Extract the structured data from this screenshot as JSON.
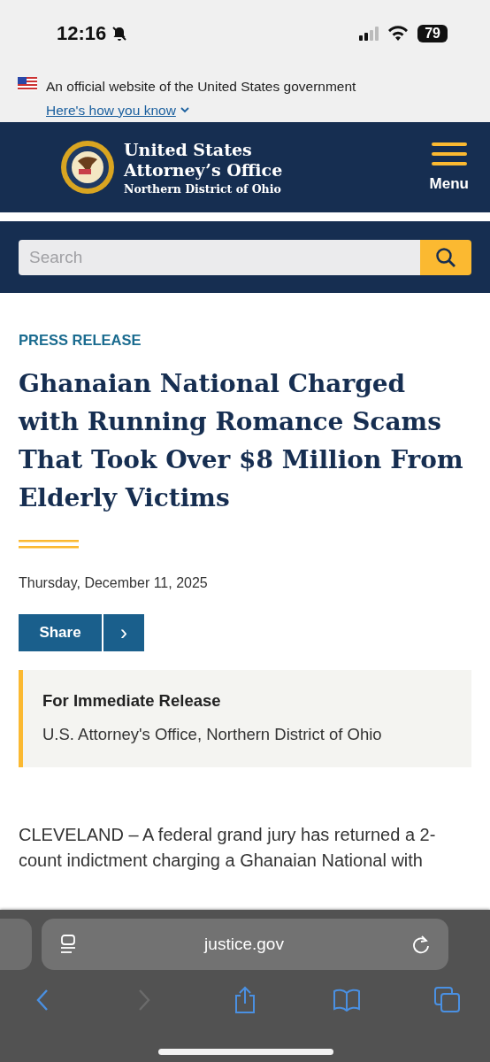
{
  "status_bar": {
    "time": "12:16",
    "battery": "79"
  },
  "gov_banner": {
    "text": "An official website of the United States government",
    "link": "Here's how you know"
  },
  "header": {
    "title_line_1": "United States",
    "title_line_2": "Attorney’s Office",
    "subtitle": "Northern District of Ohio",
    "menu_label": "Menu"
  },
  "search": {
    "placeholder": "Search"
  },
  "article": {
    "eyebrow": "PRESS RELEASE",
    "title": "Ghanaian National Charged with Running Romance Scams That Took Over $8 Million From Elderly Victims",
    "date": "Thursday, December 11, 2025",
    "share_label": "Share",
    "share_arrow": "›",
    "notice": {
      "heading": "For Immediate Release",
      "text": "U.S. Attorney's Office, Northern District of Ohio"
    },
    "body": "CLEVELAND – A federal grand jury has returned a 2-count indictment charging a Ghanaian National with"
  },
  "browser": {
    "url": "justice.gov",
    "toolbar": [
      {
        "kind": "back",
        "disabled": false
      },
      {
        "kind": "forward",
        "disabled": true
      },
      {
        "kind": "share",
        "disabled": false
      },
      {
        "kind": "bookmarks",
        "disabled": false
      },
      {
        "kind": "tabs",
        "disabled": false
      }
    ]
  }
}
